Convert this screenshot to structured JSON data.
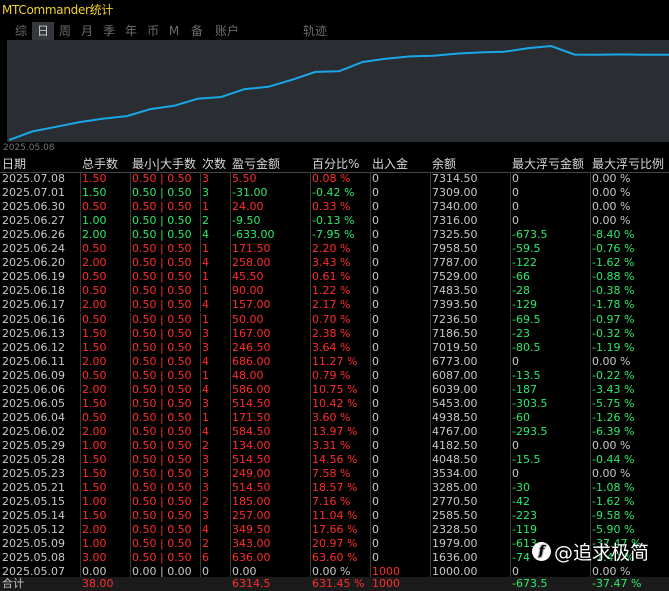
{
  "window": {
    "title": "MTCommander统计"
  },
  "tabs": [
    {
      "label": "综",
      "active": false
    },
    {
      "label": "日",
      "active": true
    },
    {
      "label": "周",
      "active": false
    },
    {
      "label": "月",
      "active": false
    },
    {
      "label": "季",
      "active": false
    },
    {
      "label": "年",
      "active": false
    },
    {
      "label": "币",
      "active": false
    },
    {
      "label": "M",
      "active": false
    },
    {
      "label": "备",
      "active": false
    },
    {
      "label": "账户",
      "active": false
    },
    {
      "label": "轨迹",
      "active": false
    }
  ],
  "chart_data": {
    "type": "line",
    "x_start_label": "2025.05.08",
    "line_color": "#1aa7e8",
    "series": [
      {
        "values": [
          1000,
          1636,
          1979,
          2328,
          2585,
          2770.5,
          3285,
          3534,
          4048.5,
          4182.5,
          4767,
          4938.5,
          5453,
          6039,
          6087,
          6773,
          7019.5,
          7186.5,
          7236.5,
          7393.5,
          7483.5,
          7529,
          7787,
          7958.5,
          7325.5,
          7316,
          7340,
          7309,
          7314.5
        ]
      }
    ]
  },
  "table": {
    "headers": [
      "日期",
      "总手数",
      "最小|大手数",
      "次数",
      "盈亏金额",
      "百分比%",
      "出入金",
      "余额",
      "最大浮亏金额",
      "最大浮亏比例"
    ],
    "rows": [
      [
        "2025.07.08",
        "1.50",
        "0.50 | 0.50",
        "3",
        "5.50",
        "0.08 %",
        "0",
        "7314.50",
        "0",
        "0.00 %"
      ],
      [
        "2025.07.01",
        "1.50",
        "0.50 | 0.50",
        "3",
        "-31.00",
        "-0.42 %",
        "0",
        "7309.00",
        "0",
        "0.00 %"
      ],
      [
        "2025.06.30",
        "0.50",
        "0.50 | 0.50",
        "1",
        "24.00",
        "0.33 %",
        "0",
        "7340.00",
        "0",
        "0.00 %"
      ],
      [
        "2025.06.27",
        "1.00",
        "0.50 | 0.50",
        "2",
        "-9.50",
        "-0.13 %",
        "0",
        "7316.00",
        "0",
        "0.00 %"
      ],
      [
        "2025.06.26",
        "2.00",
        "0.50 | 0.50",
        "4",
        "-633.00",
        "-7.95 %",
        "0",
        "7325.50",
        "-673.5",
        "-8.40 %"
      ],
      [
        "2025.06.24",
        "0.50",
        "0.50 | 0.50",
        "1",
        "171.50",
        "2.20 %",
        "0",
        "7958.50",
        "-59.5",
        "-0.76 %"
      ],
      [
        "2025.06.20",
        "2.00",
        "0.50 | 0.50",
        "4",
        "258.00",
        "3.43 %",
        "0",
        "7787.00",
        "-122",
        "-1.62 %"
      ],
      [
        "2025.06.19",
        "0.50",
        "0.50 | 0.50",
        "1",
        "45.50",
        "0.61 %",
        "0",
        "7529.00",
        "-66",
        "-0.88 %"
      ],
      [
        "2025.06.18",
        "0.50",
        "0.50 | 0.50",
        "1",
        "90.00",
        "1.22 %",
        "0",
        "7483.50",
        "-28",
        "-0.38 %"
      ],
      [
        "2025.06.17",
        "2.00",
        "0.50 | 0.50",
        "4",
        "157.00",
        "2.17 %",
        "0",
        "7393.50",
        "-129",
        "-1.78 %"
      ],
      [
        "2025.06.16",
        "0.50",
        "0.50 | 0.50",
        "1",
        "50.00",
        "0.70 %",
        "0",
        "7236.50",
        "-69.5",
        "-0.97 %"
      ],
      [
        "2025.06.13",
        "1.50",
        "0.50 | 0.50",
        "3",
        "167.00",
        "2.38 %",
        "0",
        "7186.50",
        "-23",
        "-0.32 %"
      ],
      [
        "2025.06.12",
        "1.50",
        "0.50 | 0.50",
        "3",
        "246.50",
        "3.64 %",
        "0",
        "7019.50",
        "-80.5",
        "-1.19 %"
      ],
      [
        "2025.06.11",
        "2.00",
        "0.50 | 0.50",
        "4",
        "686.00",
        "11.27 %",
        "0",
        "6773.00",
        "0",
        "0.00 %"
      ],
      [
        "2025.06.09",
        "0.50",
        "0.50 | 0.50",
        "1",
        "48.00",
        "0.79 %",
        "0",
        "6087.00",
        "-13.5",
        "-0.22 %"
      ],
      [
        "2025.06.06",
        "2.00",
        "0.50 | 0.50",
        "4",
        "586.00",
        "10.75 %",
        "0",
        "6039.00",
        "-187",
        "-3.43 %"
      ],
      [
        "2025.06.05",
        "1.50",
        "0.50 | 0.50",
        "3",
        "514.50",
        "10.42 %",
        "0",
        "5453.00",
        "-303.5",
        "-5.75 %"
      ],
      [
        "2025.06.04",
        "0.50",
        "0.50 | 0.50",
        "1",
        "171.50",
        "3.60 %",
        "0",
        "4938.50",
        "-60",
        "-1.26 %"
      ],
      [
        "2025.06.02",
        "2.00",
        "0.50 | 0.50",
        "4",
        "584.50",
        "13.97 %",
        "0",
        "4767.00",
        "-293.5",
        "-6.39 %"
      ],
      [
        "2025.05.29",
        "1.00",
        "0.50 | 0.50",
        "2",
        "134.00",
        "3.31 %",
        "0",
        "4182.50",
        "0",
        "0.00 %"
      ],
      [
        "2025.05.28",
        "1.50",
        "0.50 | 0.50",
        "3",
        "514.50",
        "14.56 %",
        "0",
        "4048.50",
        "-15.5",
        "-0.44 %"
      ],
      [
        "2025.05.23",
        "1.50",
        "0.50 | 0.50",
        "3",
        "249.00",
        "7.58 %",
        "0",
        "3534.00",
        "0",
        "0.00 %"
      ],
      [
        "2025.05.21",
        "1.50",
        "0.50 | 0.50",
        "3",
        "514.50",
        "18.57 %",
        "0",
        "3285.00",
        "-30",
        "-1.08 %"
      ],
      [
        "2025.05.15",
        "1.00",
        "0.50 | 0.50",
        "2",
        "185.00",
        "7.16 %",
        "0",
        "2770.50",
        "-42",
        "-1.62 %"
      ],
      [
        "2025.05.14",
        "1.50",
        "0.50 | 0.50",
        "3",
        "257.00",
        "11.04 %",
        "0",
        "2585.50",
        "-223",
        "-9.58 %"
      ],
      [
        "2025.05.12",
        "2.00",
        "0.50 | 0.50",
        "4",
        "349.50",
        "17.66 %",
        "0",
        "2328.50",
        "-119",
        "-5.90 %"
      ],
      [
        "2025.05.09",
        "1.00",
        "0.50 | 0.50",
        "2",
        "343.00",
        "20.97 %",
        "0",
        "1979.00",
        "-613",
        "-37.47 %"
      ],
      [
        "2025.05.08",
        "3.00",
        "0.50 | 0.50",
        "6",
        "636.00",
        "63.60 %",
        "0",
        "1636.00",
        "-74",
        "-7.40 %"
      ],
      [
        "2025.05.07",
        "0.00",
        "0.00 | 0.00",
        "0",
        "0.00",
        "0.00 %",
        "1000",
        "1000.00",
        "0",
        "0.00 %"
      ]
    ],
    "total": [
      "合计",
      "38.00",
      "",
      "",
      "6314.5",
      "631.45 %",
      "1000",
      "",
      "-673.5",
      "-37.47 %"
    ]
  },
  "watermark": {
    "icon": "zhihu-icon",
    "text": "@追求极简"
  }
}
